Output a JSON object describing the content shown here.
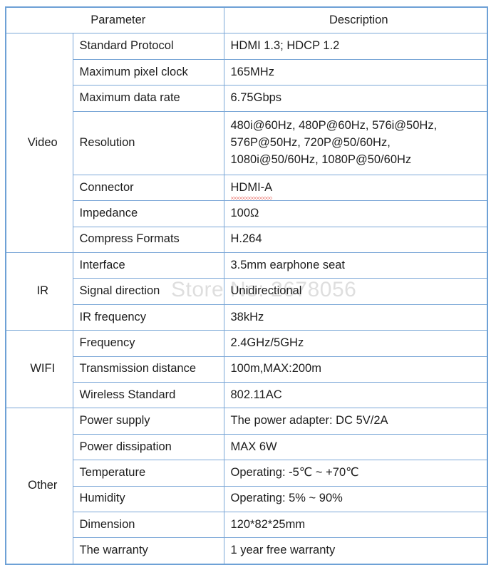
{
  "table": {
    "header": {
      "parameter": "Parameter",
      "description": "Description"
    },
    "sections": [
      {
        "category": "Video",
        "rows": [
          {
            "parameter": "Standard Protocol",
            "description": "HDMI 1.3; HDCP 1.2"
          },
          {
            "parameter": "Maximum pixel clock",
            "description": "165MHz"
          },
          {
            "parameter": "Maximum data rate",
            "description": "6.75Gbps"
          },
          {
            "parameter": "Resolution",
            "description_lines": [
              "480i@60Hz, 480P@60Hz, 576i@50Hz,",
              "576P@50Hz, 720P@50/60Hz,",
              "1080i@50/60Hz, 1080P@50/60Hz"
            ]
          },
          {
            "parameter": "Connector",
            "description": "HDMI-A",
            "spellcheck_flag": true
          },
          {
            "parameter": "Impedance",
            "description": "100Ω"
          },
          {
            "parameter": "Compress Formats",
            "description": "H.264"
          }
        ]
      },
      {
        "category": "IR",
        "rows": [
          {
            "parameter": "Interface",
            "description": "3.5mm earphone seat"
          },
          {
            "parameter": "Signal direction",
            "description": "Unidirectional"
          },
          {
            "parameter": "IR frequency",
            "description": "38kHz"
          }
        ]
      },
      {
        "category": "WIFI",
        "rows": [
          {
            "parameter": "Frequency",
            "description": "2.4GHz/5GHz"
          },
          {
            "parameter": "Transmission distance",
            "description": "100m,MAX:200m"
          },
          {
            "parameter": "Wireless Standard",
            "description": "802.11AC"
          }
        ]
      },
      {
        "category": "Other",
        "rows": [
          {
            "parameter": "Power supply",
            "description": "The power adapter: DC 5V/2A"
          },
          {
            "parameter": "Power dissipation",
            "description": "MAX 6W"
          },
          {
            "parameter": "Temperature",
            "description": "Operating: -5℃  ~ +70℃"
          },
          {
            "parameter": "Humidity",
            "description": "Operating: 5% ~ 90%"
          },
          {
            "parameter": "Dimension",
            "description": "120*82*25mm"
          },
          {
            "parameter": "The warranty",
            "description": "1 year free warranty"
          }
        ]
      }
    ]
  },
  "watermark": {
    "text": "Store No: 2678056"
  },
  "colors": {
    "border": "#7BA7D7",
    "text": "#1d1d1d",
    "spellcheck": "#e03a2f",
    "watermark": "rgba(0,0,0,0.13)",
    "background": "#ffffff"
  }
}
